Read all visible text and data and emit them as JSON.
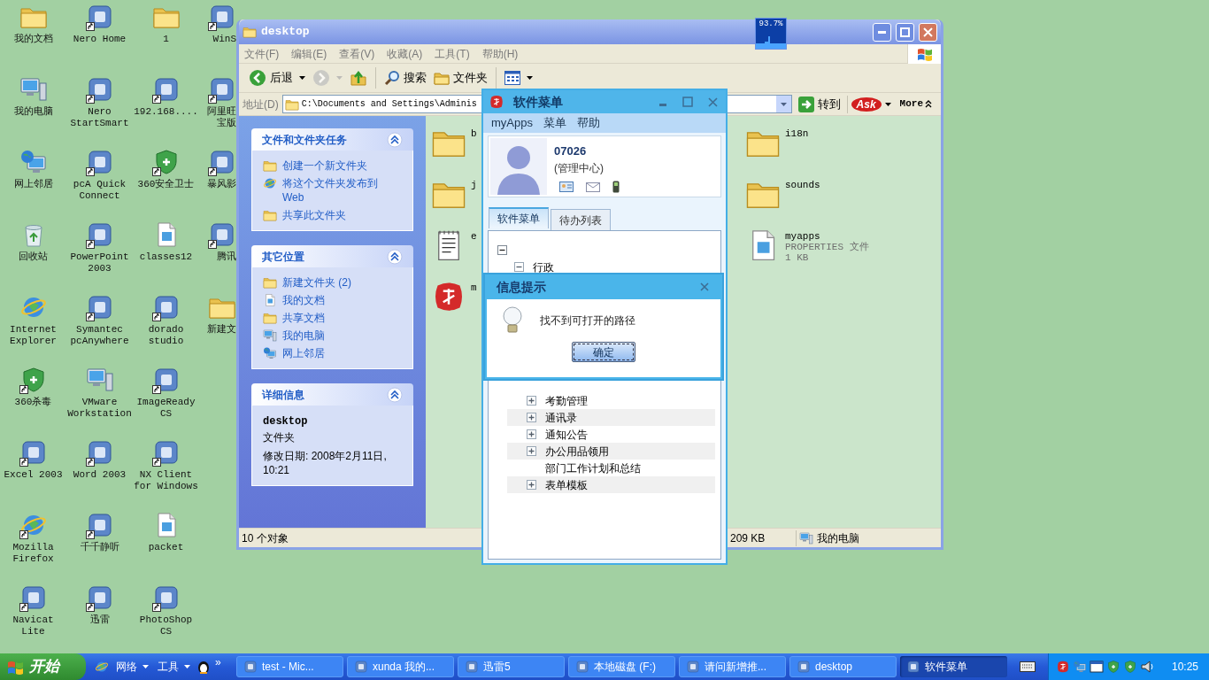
{
  "desktop_icons": [
    [
      {
        "label": "我的文档",
        "kind": "folder",
        "shortcut": false
      },
      {
        "label": "我的电脑",
        "kind": "computer",
        "shortcut": false
      },
      {
        "label": "网上邻居",
        "kind": "network",
        "shortcut": false
      },
      {
        "label": "回收站",
        "kind": "recycle",
        "shortcut": false
      },
      {
        "label": "Internet Explorer",
        "kind": "globe",
        "shortcut": false
      },
      {
        "label": "360杀毒",
        "kind": "shield",
        "shortcut": true
      },
      {
        "label": "Excel 2003",
        "kind": "app",
        "shortcut": true
      },
      {
        "label": "Mozilla Firefox",
        "kind": "globe",
        "shortcut": true
      },
      {
        "label": "Navicat Lite",
        "kind": "app",
        "shortcut": true
      }
    ],
    [
      {
        "label": "Nero Home",
        "kind": "app",
        "shortcut": true
      },
      {
        "label": "Nero StartSmart",
        "kind": "app",
        "shortcut": true
      },
      {
        "label": "pcA Quick Connect",
        "kind": "app",
        "shortcut": true
      },
      {
        "label": "PowerPoint 2003",
        "kind": "app",
        "shortcut": true
      },
      {
        "label": "Symantec pcAnywhere",
        "kind": "app",
        "shortcut": true
      },
      {
        "label": "VMware Workstation",
        "kind": "computer",
        "shortcut": false
      },
      {
        "label": "Word 2003",
        "kind": "app",
        "shortcut": true
      },
      {
        "label": "千千静听",
        "kind": "app",
        "shortcut": true
      },
      {
        "label": "迅雷",
        "kind": "app",
        "shortcut": true
      }
    ],
    [
      {
        "label": "1",
        "kind": "folder",
        "shortcut": false
      },
      {
        "label": "192.168....",
        "kind": "app",
        "shortcut": true
      },
      {
        "label": "360安全卫士",
        "kind": "shield",
        "shortcut": true
      },
      {
        "label": "classes12",
        "kind": "document",
        "shortcut": false
      },
      {
        "label": "dorado studio",
        "kind": "app",
        "shortcut": true
      },
      {
        "label": "ImageReady CS",
        "kind": "app",
        "shortcut": true
      },
      {
        "label": "NX Client for Windows",
        "kind": "app",
        "shortcut": true
      },
      {
        "label": "packet",
        "kind": "document",
        "shortcut": false
      },
      {
        "label": "PhotoShop CS",
        "kind": "app",
        "shortcut": true
      }
    ],
    [
      {
        "label": "WinS",
        "kind": "app",
        "shortcut": true
      },
      {
        "label": "阿里旺宝版",
        "kind": "app",
        "shortcut": true
      },
      {
        "label": "暴风影",
        "kind": "app",
        "shortcut": true
      },
      {
        "label": "腾讯",
        "kind": "app",
        "shortcut": true
      },
      {
        "label": "新建文",
        "kind": "folder",
        "shortcut": false
      }
    ]
  ],
  "meter_widget": {
    "reading": "93.7%"
  },
  "explorer": {
    "title": "desktop",
    "menu": [
      "文件(F)",
      "编辑(E)",
      "查看(V)",
      "收藏(A)",
      "工具(T)",
      "帮助(H)"
    ],
    "toolbar": [
      {
        "kind": "back",
        "label": "后退",
        "dropdown": true,
        "disabled": false
      },
      {
        "kind": "forward",
        "dropdown": true,
        "disabled": true
      },
      {
        "kind": "up",
        "dropdown": false,
        "disabled": false
      },
      {
        "kind": "search",
        "label": "搜索",
        "dropdown": false,
        "disabled": false
      },
      {
        "kind": "folders",
        "label": "文件夹",
        "dropdown": false,
        "disabled": false
      },
      {
        "kind": "views",
        "dropdown": true,
        "disabled": false
      }
    ],
    "address": {
      "label": "地址(D)",
      "value": "C:\\Documents and Settings\\Adminis",
      "go": "转到",
      "ask": "Ask",
      "more": "More"
    },
    "tasks_pane": [
      {
        "title": "文件和文件夹任务",
        "expanded": true,
        "items": [
          {
            "label": "创建一个新文件夹",
            "kind": "folder"
          },
          {
            "label": "将这个文件夹发布到 Web",
            "kind": "globe"
          },
          {
            "label": "共享此文件夹",
            "kind": "folder"
          }
        ]
      },
      {
        "title": "其它位置",
        "expanded": true,
        "items": [
          {
            "label": "新建文件夹 (2)",
            "kind": "folder"
          },
          {
            "label": "我的文档",
            "kind": "document"
          },
          {
            "label": "共享文档",
            "kind": "folder"
          },
          {
            "label": "我的电脑",
            "kind": "computer"
          },
          {
            "label": "网上邻居",
            "kind": "network"
          }
        ]
      },
      {
        "title": "详细信息",
        "expanded": true,
        "details": {
          "name": "desktop",
          "type": "文件夹",
          "modified": "修改日期: 2008年2月11日, 10:21"
        }
      }
    ],
    "files": [
      {
        "label": "b",
        "kind": "folder"
      },
      {
        "label": "i18n",
        "kind": "folder"
      },
      {
        "label": "j",
        "kind": "folder"
      },
      {
        "label": "sounds",
        "kind": "folder"
      },
      {
        "label": "e",
        "kind": "notepad"
      },
      {
        "label": "myapps",
        "kind": "document",
        "lines": [
          "PROPERTIES 文件",
          "1 KB"
        ]
      },
      {
        "label": "m",
        "kind": "logo"
      }
    ],
    "status_bar": {
      "objects": "10 个对象",
      "size": "209 KB",
      "zone": "我的电脑"
    }
  },
  "software_menu": {
    "title": "软件菜单",
    "menu": [
      "myApps",
      "菜单",
      "帮助"
    ],
    "profile": {
      "id": "07026",
      "org": "(管理中心)"
    },
    "tabs": [
      {
        "label": "软件菜单",
        "selected": true
      },
      {
        "label": "待办列表",
        "selected": false
      }
    ],
    "tree": {
      "expanded": true,
      "children": [
        {
          "label": "行政",
          "kind": "group",
          "expanded": true,
          "children": [
            {
              "label": "考勤管理",
              "kind": "group",
              "expanded": false
            },
            {
              "label": "通讯录",
              "kind": "group",
              "expanded": false
            },
            {
              "label": "通知公告",
              "kind": "group",
              "expanded": false
            },
            {
              "label": "办公用品领用",
              "kind": "group",
              "expanded": false
            },
            {
              "label": "部门工作计划和总结",
              "kind": "leaf"
            },
            {
              "label": "表单模板",
              "kind": "group",
              "expanded": false
            }
          ]
        }
      ]
    }
  },
  "dialog": {
    "title": "信息提示",
    "message": "找不到可打开的路径",
    "button": "确定"
  },
  "taskbar": {
    "start": "开始",
    "quick_launch": [
      {
        "label": "网络"
      },
      {
        "label": "工具"
      }
    ],
    "more": "»",
    "tasks": [
      {
        "label": "test - Mic...",
        "selected": false
      },
      {
        "label": "xunda 我的...",
        "selected": false
      },
      {
        "label": "迅雷5",
        "selected": false
      },
      {
        "label": "本地磁盘 (F:)",
        "selected": false
      },
      {
        "label": "请问新增推...",
        "selected": false
      },
      {
        "label": "desktop",
        "selected": false
      },
      {
        "label": "软件菜单",
        "selected": true
      }
    ],
    "clock": "10:25"
  }
}
